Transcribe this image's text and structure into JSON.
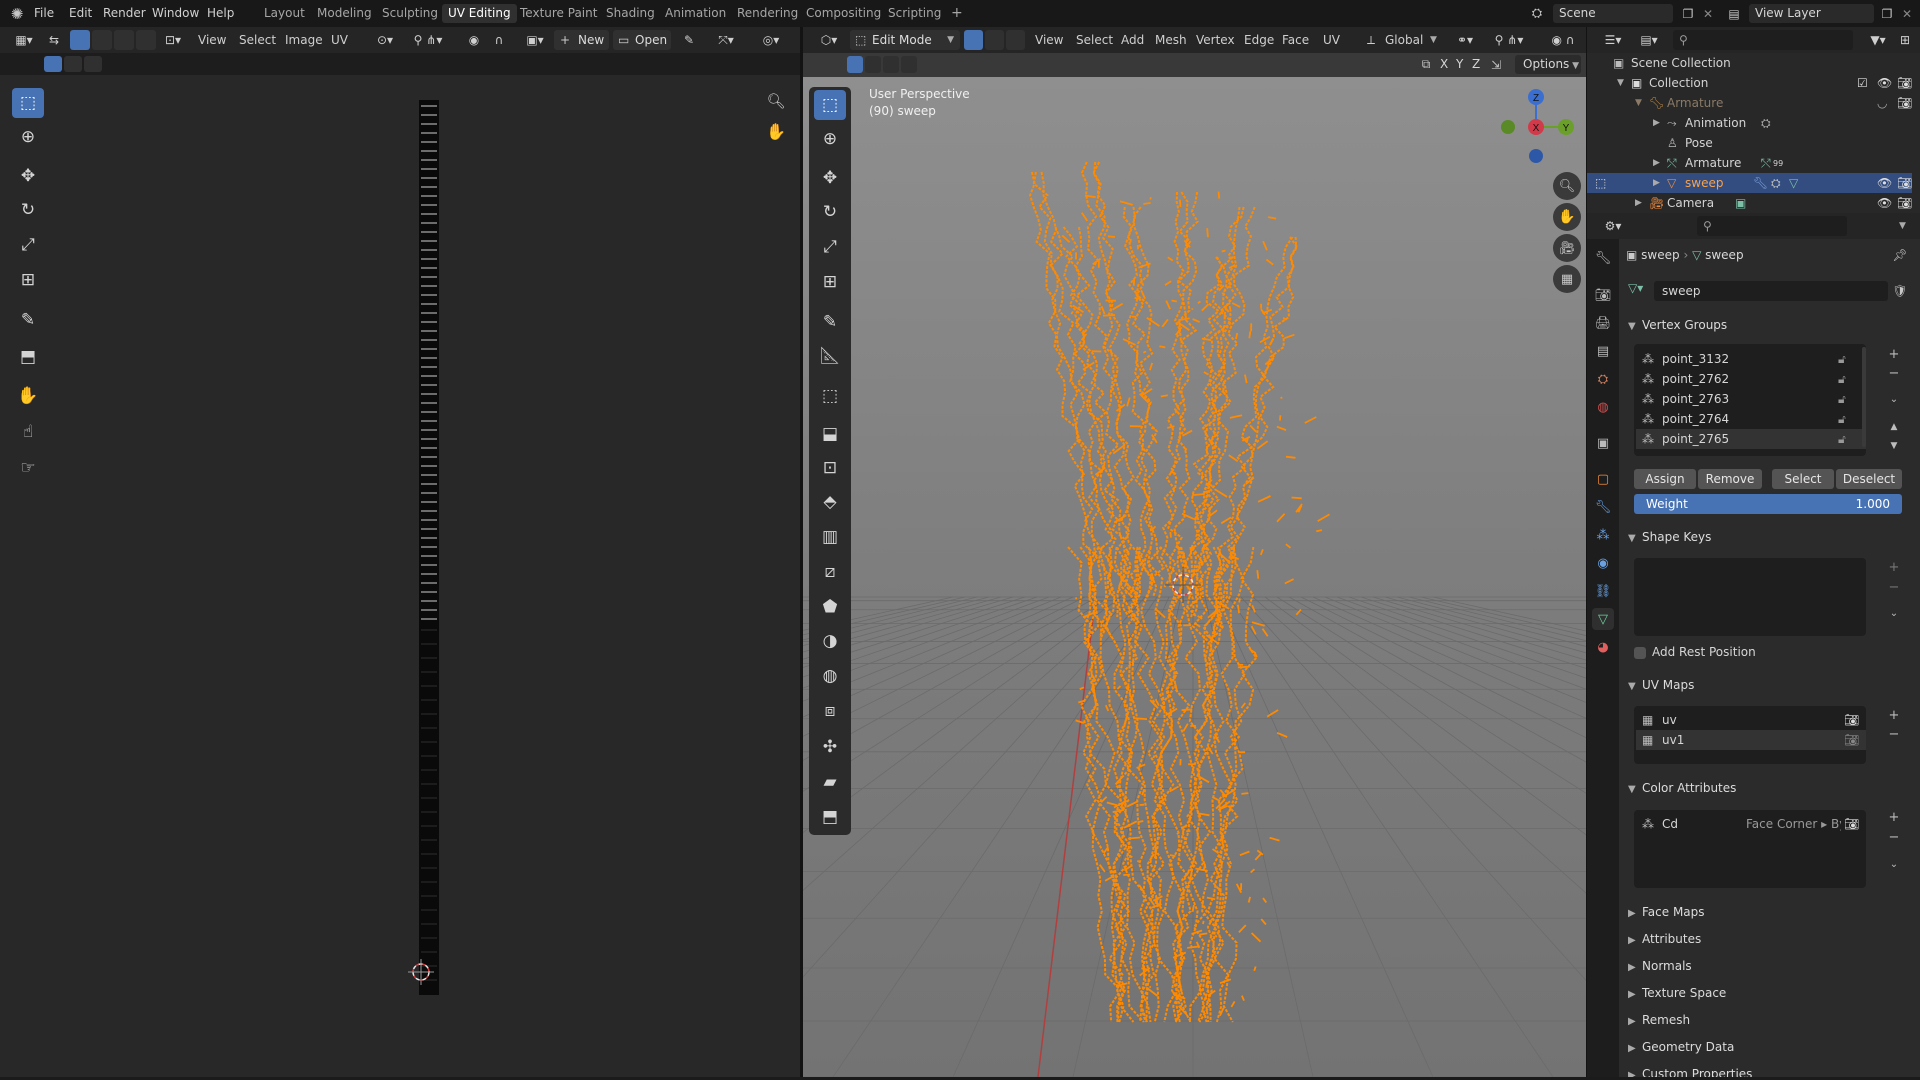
{
  "topbar": {
    "menus": [
      "File",
      "Edit",
      "Render",
      "Window",
      "Help"
    ],
    "workspaces": [
      "Layout",
      "Modeling",
      "Sculpting",
      "UV Editing",
      "Texture Paint",
      "Shading",
      "Animation",
      "Rendering",
      "Compositing",
      "Scripting"
    ],
    "active_workspace": "UV Editing",
    "add_tab": "+",
    "scene": "Scene",
    "view_layer": "View Layer"
  },
  "uv_editor": {
    "menus": [
      "View",
      "Select",
      "Image",
      "UV"
    ],
    "new_label": "New",
    "open_label": "Open"
  },
  "viewport": {
    "mode": "Edit Mode",
    "menus": [
      "View",
      "Select",
      "Add",
      "Mesh",
      "Vertex",
      "Edge",
      "Face",
      "UV"
    ],
    "orientation": "Global",
    "axes": [
      "X",
      "Y",
      "Z"
    ],
    "options_label": "Options",
    "overlay_title": "User Perspective",
    "overlay_object": "(90) sweep",
    "gizmo": {
      "x": "X",
      "y": "Y",
      "z": "Z"
    },
    "accent_mesh": "#ff8a00"
  },
  "outliner": {
    "rows": [
      {
        "label": "Scene Collection"
      },
      {
        "label": "Collection"
      },
      {
        "label": "Armature"
      },
      {
        "label": "Animation"
      },
      {
        "label": "Pose"
      },
      {
        "label": "Armature"
      },
      {
        "label": "sweep"
      },
      {
        "label": "Camera"
      }
    ],
    "armature_badge": "99"
  },
  "properties": {
    "breadcrumb": [
      "sweep",
      "sweep"
    ],
    "mesh_name": "sweep",
    "vertex_groups": {
      "title": "Vertex Groups",
      "items": [
        "point_3132",
        "point_2762",
        "point_2763",
        "point_2764",
        "point_2765"
      ],
      "assign": "Assign",
      "remove": "Remove",
      "select": "Select",
      "deselect": "Deselect",
      "weight_label": "Weight",
      "weight_value": "1.000"
    },
    "shape_keys": {
      "title": "Shape Keys",
      "add_rest": "Add Rest Position"
    },
    "uv_maps": {
      "title": "UV Maps",
      "items": [
        "uv",
        "uv1"
      ]
    },
    "color_attributes": {
      "title": "Color Attributes",
      "items": [
        {
          "name": "Cd",
          "domain": "Face Corner ▸ Byt..."
        }
      ]
    },
    "collapsed_panels": [
      "Face Maps",
      "Attributes",
      "Normals",
      "Texture Space",
      "Remesh",
      "Geometry Data",
      "Custom Properties"
    ]
  }
}
